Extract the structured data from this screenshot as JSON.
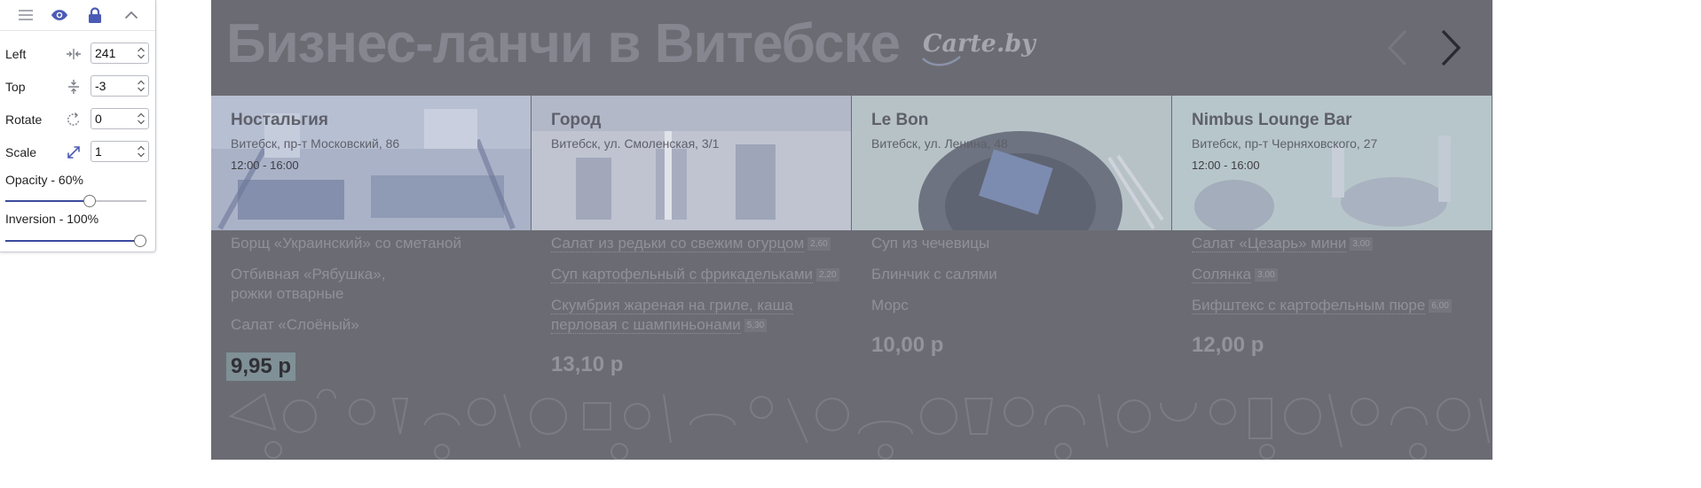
{
  "panel": {
    "toolbar": [
      "menu-icon",
      "eye-icon",
      "lock-icon",
      "chevron-up-icon"
    ],
    "fields": [
      {
        "label": "Left",
        "value": "241",
        "icon": "horizontal-align-icon"
      },
      {
        "label": "Top",
        "value": "-3",
        "icon": "vertical-align-icon"
      },
      {
        "label": "Rotate",
        "value": "0",
        "icon": "rotate-icon"
      },
      {
        "label": "Scale",
        "value": "1",
        "icon": "scale-icon"
      }
    ],
    "opacity_label": "Opacity - 60%",
    "opacity_level": 0.6,
    "inversion_label": "Inversion - 100%",
    "inversion_level": 1.0,
    "colors": {
      "accent": "#4b5bb5",
      "track": "#3b4a9e"
    }
  },
  "site": {
    "title": "Бизнес-ланчи в Витебске",
    "logo": "Carte.by",
    "cards": [
      {
        "name": "Ностальгия",
        "address": "Витебск, пр-т Московский, 86",
        "hours": "12:00 - 16:00"
      },
      {
        "name": "Город",
        "address": "Витебск, ул. Смоленская, 3/1",
        "hours": ""
      },
      {
        "name": "Le Bon",
        "address": "Витебск, ул. Ленина, 48",
        "hours": ""
      },
      {
        "name": "Nimbus Lounge Bar",
        "address": "Витебск, пр-т Черняховского, 27",
        "hours": "12:00 - 16:00"
      }
    ],
    "menus": [
      {
        "dishes": [
          {
            "text": "Борщ «Украинский» со сметаной",
            "price": ""
          },
          {
            "text": "Отбивная «Рябушка»,\nрожки отварные",
            "price": ""
          },
          {
            "text": "Салат «Слоёный»",
            "price": ""
          }
        ],
        "total": "9,95 р"
      },
      {
        "dishes": [
          {
            "text": "Салат из редьки со свежим огурцом",
            "price": "2,60"
          },
          {
            "text": "Суп картофельный с фрикадельками",
            "price": "2,20"
          },
          {
            "text": "Скумбрия жареная на гриле, каша перловая с шампиньонами",
            "price": "5,30"
          }
        ],
        "total": "13,10 р"
      },
      {
        "dishes": [
          {
            "text": "Суп из чечевицы",
            "price": ""
          },
          {
            "text": "Блинчик с салями",
            "price": ""
          },
          {
            "text": "Морс",
            "price": ""
          }
        ],
        "total": "10,00 р"
      },
      {
        "dishes": [
          {
            "text": "Салат «Цезарь» мини",
            "price": "3,00"
          },
          {
            "text": "Солянка",
            "price": "3,00"
          },
          {
            "text": "Бифштекс с картофельным пюре",
            "price": "6,00"
          }
        ],
        "total": "12,00 р"
      }
    ]
  }
}
